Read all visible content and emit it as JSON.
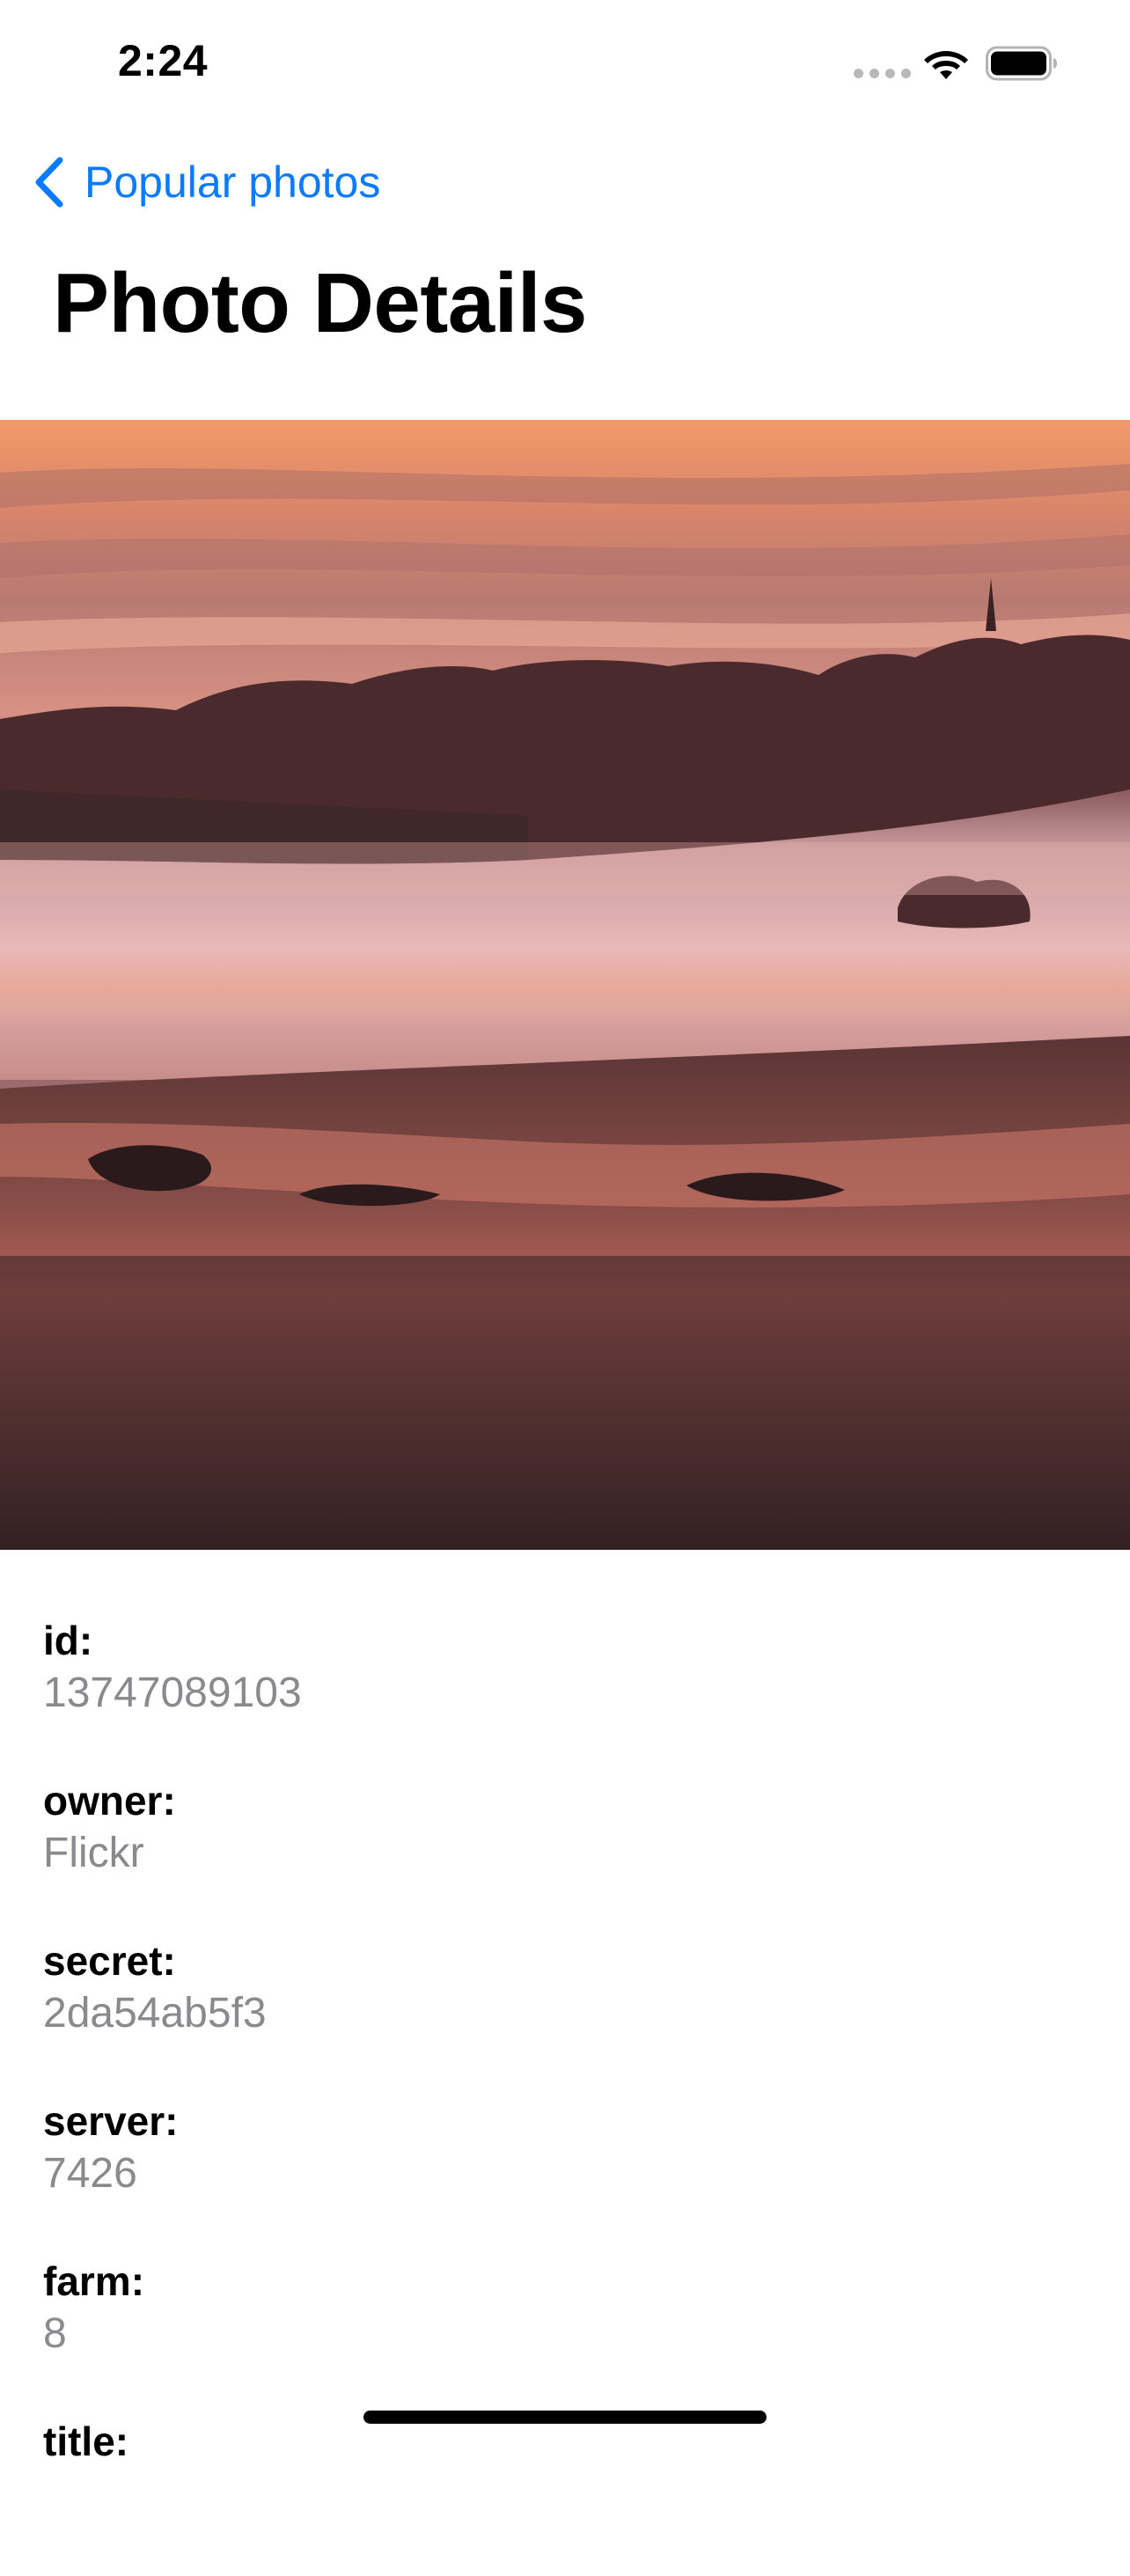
{
  "status_bar": {
    "time": "2:24",
    "icons": [
      "cellular-signal-icon",
      "wifi-icon",
      "battery-icon"
    ]
  },
  "nav": {
    "back_label": "Popular photos",
    "back_icon": "chevron-left-icon",
    "accent_color": "#0a7aff"
  },
  "page": {
    "title": "Photo Details"
  },
  "photo": {
    "alt": "Misty landscape at sunset with trees on a hill"
  },
  "details": [
    {
      "label": "id:",
      "value": "13747089103"
    },
    {
      "label": "owner:",
      "value": "Flickr"
    },
    {
      "label": "secret:",
      "value": "2da54ab5f3"
    },
    {
      "label": "server:",
      "value": "7426"
    },
    {
      "label": "farm:",
      "value": "8"
    },
    {
      "label": "title:",
      "value": ""
    }
  ]
}
